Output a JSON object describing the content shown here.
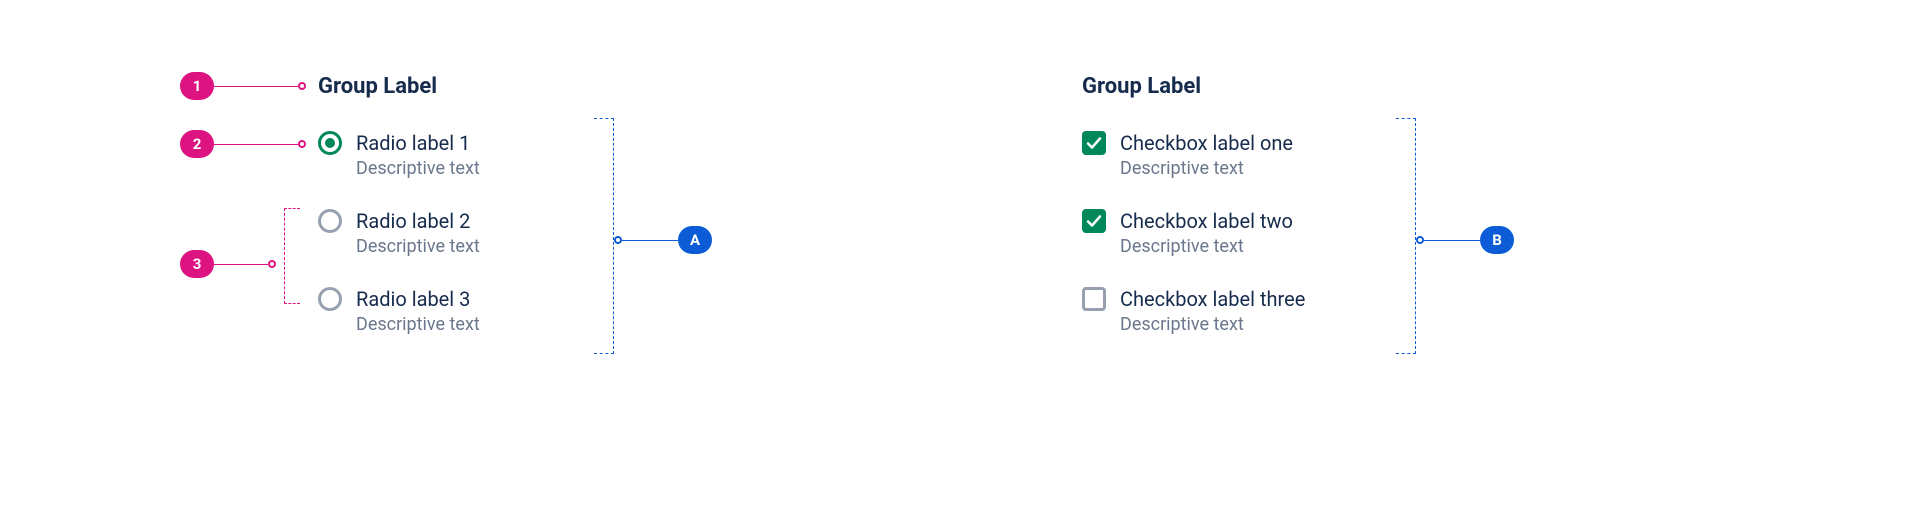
{
  "radio_group": {
    "group_label": "Group Label",
    "items": [
      {
        "label": "Radio label 1",
        "desc": "Descriptive text",
        "selected": true
      },
      {
        "label": "Radio label 2",
        "desc": "Descriptive text",
        "selected": false
      },
      {
        "label": "Radio label 3",
        "desc": "Descriptive text",
        "selected": false
      }
    ]
  },
  "checkbox_group": {
    "group_label": "Group Label",
    "items": [
      {
        "label": "Checkbox label one",
        "desc": "Descriptive text",
        "checked": true
      },
      {
        "label": "Checkbox label two",
        "desc": "Descriptive text",
        "checked": true
      },
      {
        "label": "Checkbox label three",
        "desc": "Descriptive text",
        "checked": false
      }
    ]
  },
  "annotations": {
    "n1": "1",
    "n2": "2",
    "n3": "3",
    "a": "A",
    "b": "B"
  }
}
